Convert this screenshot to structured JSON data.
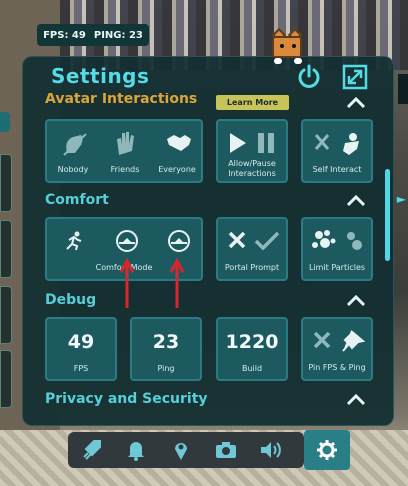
{
  "hud": {
    "fps_text": "FPS: 49",
    "ping_text": "PING: 23"
  },
  "settings": {
    "title": "Settings",
    "sections": {
      "avatar": {
        "title": "Avatar Interactions",
        "learn_more": "Learn More",
        "options": [
          "Nobody",
          "Friends",
          "Everyone"
        ],
        "allow_pause": "Allow/Pause Interactions",
        "self_interact": "Self Interact"
      },
      "comfort": {
        "title": "Comfort",
        "comfort_mode": "Comfort Mode",
        "portal_prompt": "Portal Prompt",
        "limit_particles": "Limit Particles"
      },
      "debug": {
        "title": "Debug",
        "fps_value": "49",
        "fps_label": "FPS",
        "ping_value": "23",
        "ping_label": "Ping",
        "build_value": "1220",
        "build_label": "Build",
        "pin_label": "Pin FPS & Ping"
      },
      "privacy": {
        "title": "Privacy and Security"
      }
    }
  },
  "dock": {
    "items": [
      "rocket-icon",
      "bell-icon",
      "location-pin-icon",
      "camera-icon",
      "speaker-icon",
      "gear-icon"
    ]
  },
  "colors": {
    "accent": "#55dbe6",
    "panel": "#122e32",
    "tile": "#1d5a60",
    "avatar_title": "#d9a63a",
    "annotation_red": "#d8262a"
  }
}
